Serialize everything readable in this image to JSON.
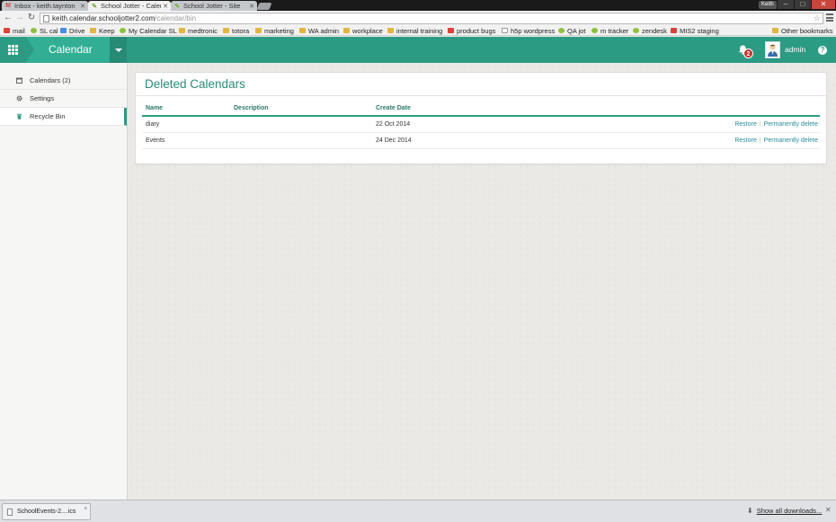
{
  "browser": {
    "tabs": [
      {
        "title": "Inbox - keith.taynton",
        "icon": "gmail-icon"
      },
      {
        "title": "School Jotter - Calen",
        "icon": "jotter-icon",
        "active": true
      },
      {
        "title": "School Jotter - Site",
        "icon": "jotter-icon"
      }
    ],
    "window_user": "Keith",
    "url_host": "keith.calendar.schooljotter2.com",
    "url_path": "/calendar/bin",
    "bookmarks": [
      {
        "label": "mail",
        "icon": "gmail"
      },
      {
        "label": "SL cal",
        "icon": "gen"
      },
      {
        "label": "Drive",
        "icon": "drive"
      },
      {
        "label": "Keep",
        "icon": "keep"
      },
      {
        "label": "My Calendar SL",
        "icon": "gen"
      },
      {
        "label": "medtronic",
        "icon": "folder"
      },
      {
        "label": "totora",
        "icon": "folder"
      },
      {
        "label": "marketing",
        "icon": "folder"
      },
      {
        "label": "WA admin",
        "icon": "folder"
      },
      {
        "label": "workplace",
        "icon": "folder"
      },
      {
        "label": "internal training",
        "icon": "folder"
      },
      {
        "label": "product bugs",
        "icon": "red"
      },
      {
        "label": "h5p wordpress",
        "icon": "page"
      },
      {
        "label": "QA jot",
        "icon": "gen"
      },
      {
        "label": "m tracker",
        "icon": "gen"
      },
      {
        "label": "zendesk",
        "icon": "gen"
      },
      {
        "label": "MIS2 staging",
        "icon": "red"
      }
    ],
    "other_bookmarks": "Other bookmarks"
  },
  "app": {
    "name": "Calendar",
    "notification_count": "2",
    "user": "admin",
    "help": "?"
  },
  "sidebar": {
    "items": [
      {
        "label": "Calendars (2)",
        "icon": "calendar-icon"
      },
      {
        "label": "Settings",
        "icon": "gear-icon"
      },
      {
        "label": "Recycle Bin",
        "icon": "trash-icon",
        "active": true
      }
    ]
  },
  "main": {
    "title": "Deleted Calendars",
    "columns": [
      "Name",
      "Description",
      "Create Date"
    ],
    "rows": [
      {
        "name": "diary",
        "description": "",
        "date": "22 Oct 2014",
        "restore": "Restore",
        "delete": "Permanently delete"
      },
      {
        "name": "Events",
        "description": "",
        "date": "24 Dec 2014",
        "restore": "Restore",
        "delete": "Permanently delete"
      }
    ],
    "action_separator": "|"
  },
  "downloads": {
    "file": "SchoolEvents-2....ics",
    "show_all": "Show all downloads..."
  },
  "colors": {
    "brand": "#2c9b84",
    "brand_light": "#31ae94",
    "link": "#2a8c9a",
    "badge": "#c9302c"
  }
}
